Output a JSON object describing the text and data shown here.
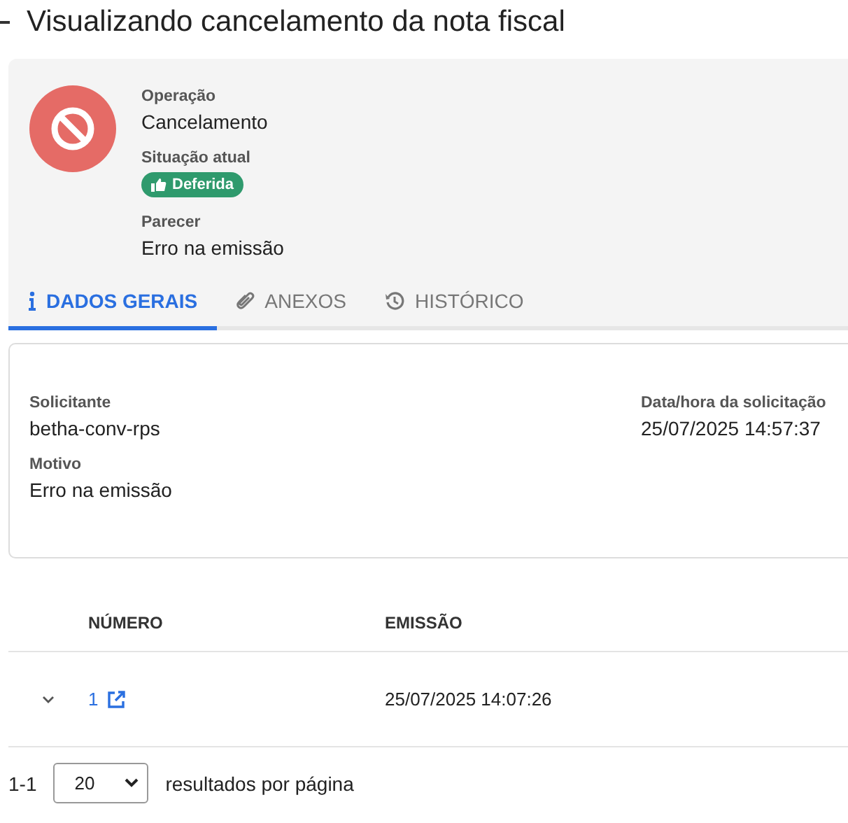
{
  "page": {
    "title": "Visualizando cancelamento da nota fiscal"
  },
  "summary": {
    "fields": [
      {
        "label": "Operação",
        "value": "Cancelamento",
        "kind": "text"
      },
      {
        "label": "Situação atual",
        "value": "Deferida",
        "kind": "badge"
      },
      {
        "label": "Parecer",
        "value": "Erro na emissão",
        "kind": "text"
      }
    ]
  },
  "tabs": [
    {
      "label": "DADOS GERAIS",
      "kind": "info",
      "selected": true
    },
    {
      "label": "ANEXOS",
      "kind": "attachments",
      "selected": false
    },
    {
      "label": "HISTÓRICO",
      "kind": "history",
      "selected": false
    }
  ],
  "details": {
    "left": [
      {
        "label": "Solicitante",
        "value": "betha-conv-rps"
      },
      {
        "label": "Motivo",
        "value": "Erro na emissão"
      }
    ],
    "right": [
      {
        "label": "Data/hora da solicitação",
        "value": "25/07/2025 14:57:37"
      }
    ]
  },
  "table": {
    "columns": [
      "NÚMERO",
      "EMISSÃO"
    ],
    "rows": [
      {
        "expanded": false,
        "numero": "1",
        "emissao": "25/07/2025 14:07:26"
      }
    ]
  },
  "pagination": {
    "range": "1-1",
    "page_size": "20",
    "label": "resultados por página"
  }
}
